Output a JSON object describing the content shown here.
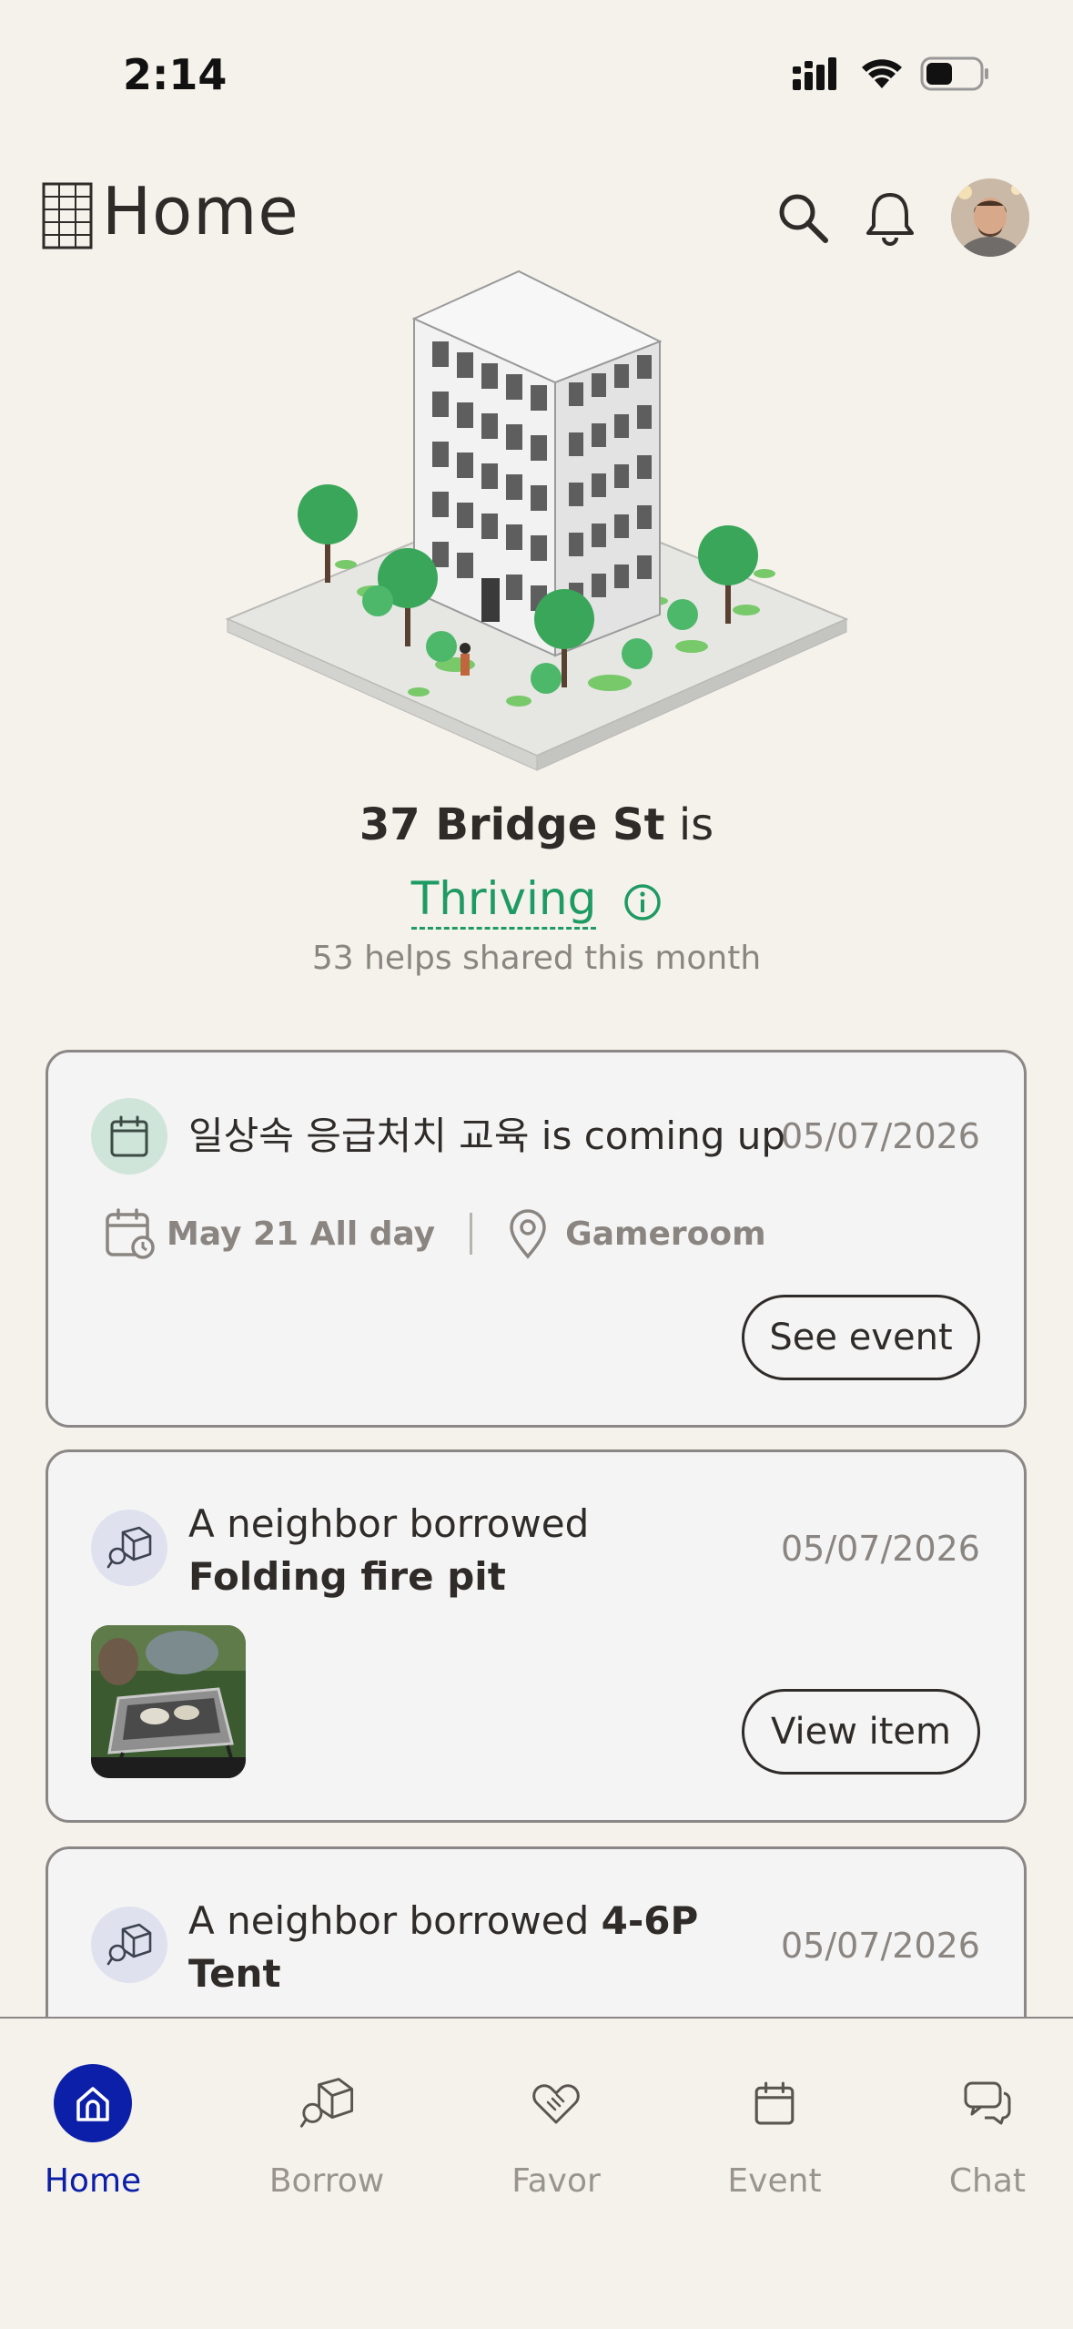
{
  "status_bar": {
    "time": "2:14"
  },
  "header": {
    "title": "Home"
  },
  "building": {
    "address": "37 Bridge St",
    "is_word": "is",
    "status": "Thriving",
    "helps_text": "53 helps shared this month"
  },
  "cards": [
    {
      "title_plain": "일상속 응급처치 교육 is coming up",
      "date": "05/07/2026",
      "when": "May 21 All day",
      "where": "Gameroom",
      "button": "See event"
    },
    {
      "title_prefix": "A neighbor borrowed ",
      "title_bold": "Folding fire pit",
      "date": "05/07/2026",
      "button": "View item"
    },
    {
      "title_prefix": "A neighbor borrowed ",
      "title_bold": "4-6P Tent",
      "date": "05/07/2026"
    }
  ],
  "nav": {
    "items": [
      {
        "label": "Home",
        "active": true
      },
      {
        "label": "Borrow"
      },
      {
        "label": "Favor"
      },
      {
        "label": "Event"
      },
      {
        "label": "Chat"
      }
    ]
  },
  "colors": {
    "accent": "#0b1fa8",
    "thriving": "#1e9a63",
    "background": "#f5f1eb"
  }
}
